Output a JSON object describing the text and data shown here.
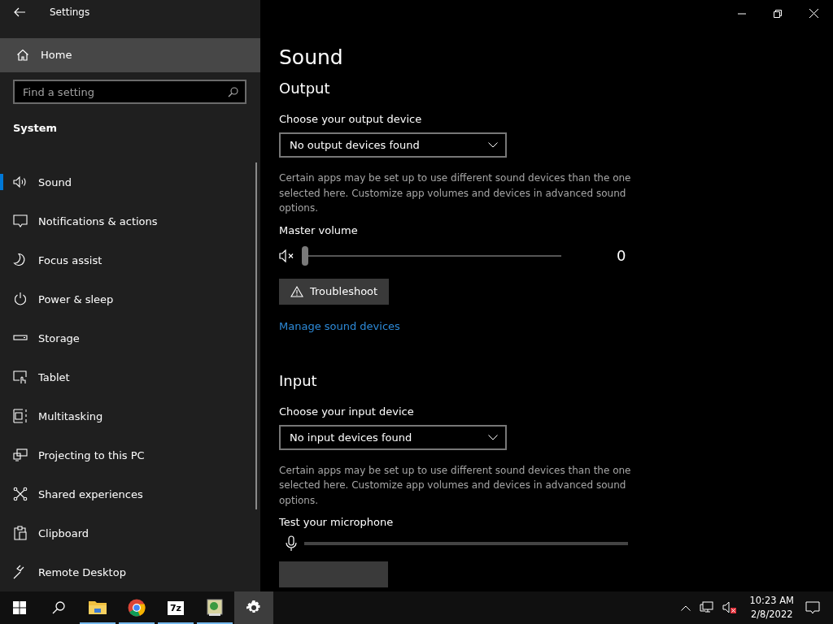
{
  "window": {
    "title": "Settings"
  },
  "sidebar": {
    "home": "Home",
    "search": {
      "placeholder": "Find a setting"
    },
    "section": "System",
    "items": [
      {
        "label": "Sound",
        "kind": "sound",
        "selected": true
      },
      {
        "label": "Notifications & actions",
        "kind": "notifications",
        "selected": false
      },
      {
        "label": "Focus assist",
        "kind": "focus",
        "selected": false
      },
      {
        "label": "Power & sleep",
        "kind": "power",
        "selected": false
      },
      {
        "label": "Storage",
        "kind": "storage",
        "selected": false
      },
      {
        "label": "Tablet",
        "kind": "tablet",
        "selected": false
      },
      {
        "label": "Multitasking",
        "kind": "multitasking",
        "selected": false
      },
      {
        "label": "Projecting to this PC",
        "kind": "projecting",
        "selected": false
      },
      {
        "label": "Shared experiences",
        "kind": "shared",
        "selected": false
      },
      {
        "label": "Clipboard",
        "kind": "clipboard",
        "selected": false
      },
      {
        "label": "Remote Desktop",
        "kind": "remote",
        "selected": false
      }
    ]
  },
  "page_title": "Sound",
  "output": {
    "heading": "Output",
    "device_label": "Choose your output device",
    "device_value": "No output devices found",
    "note": "Certain apps may be set up to use different sound devices than the one selected here. Customize app volumes and devices in advanced sound options.",
    "volume_label": "Master volume",
    "muted": true,
    "level": 0,
    "reading": "0",
    "troubleshoot": "Troubleshoot",
    "link": "Manage sound devices"
  },
  "input": {
    "heading": "Input",
    "device_label": "Choose your input device",
    "device_value": "No input devices found",
    "note": "Certain apps may be set up to use different sound devices than the one selected here. Customize app volumes and devices in advanced sound options.",
    "mic_label": "Test your microphone",
    "level": 0
  },
  "taskbar": {
    "apps": [
      {
        "kind": "explorer",
        "selected": false
      },
      {
        "kind": "chrome",
        "selected": false
      },
      {
        "kind": "archiver",
        "text": "7z",
        "selected": false
      },
      {
        "kind": "app",
        "selected": false
      },
      {
        "kind": "settings",
        "selected": true
      }
    ],
    "time": "10:23 AM",
    "date": "2/8/2022"
  }
}
